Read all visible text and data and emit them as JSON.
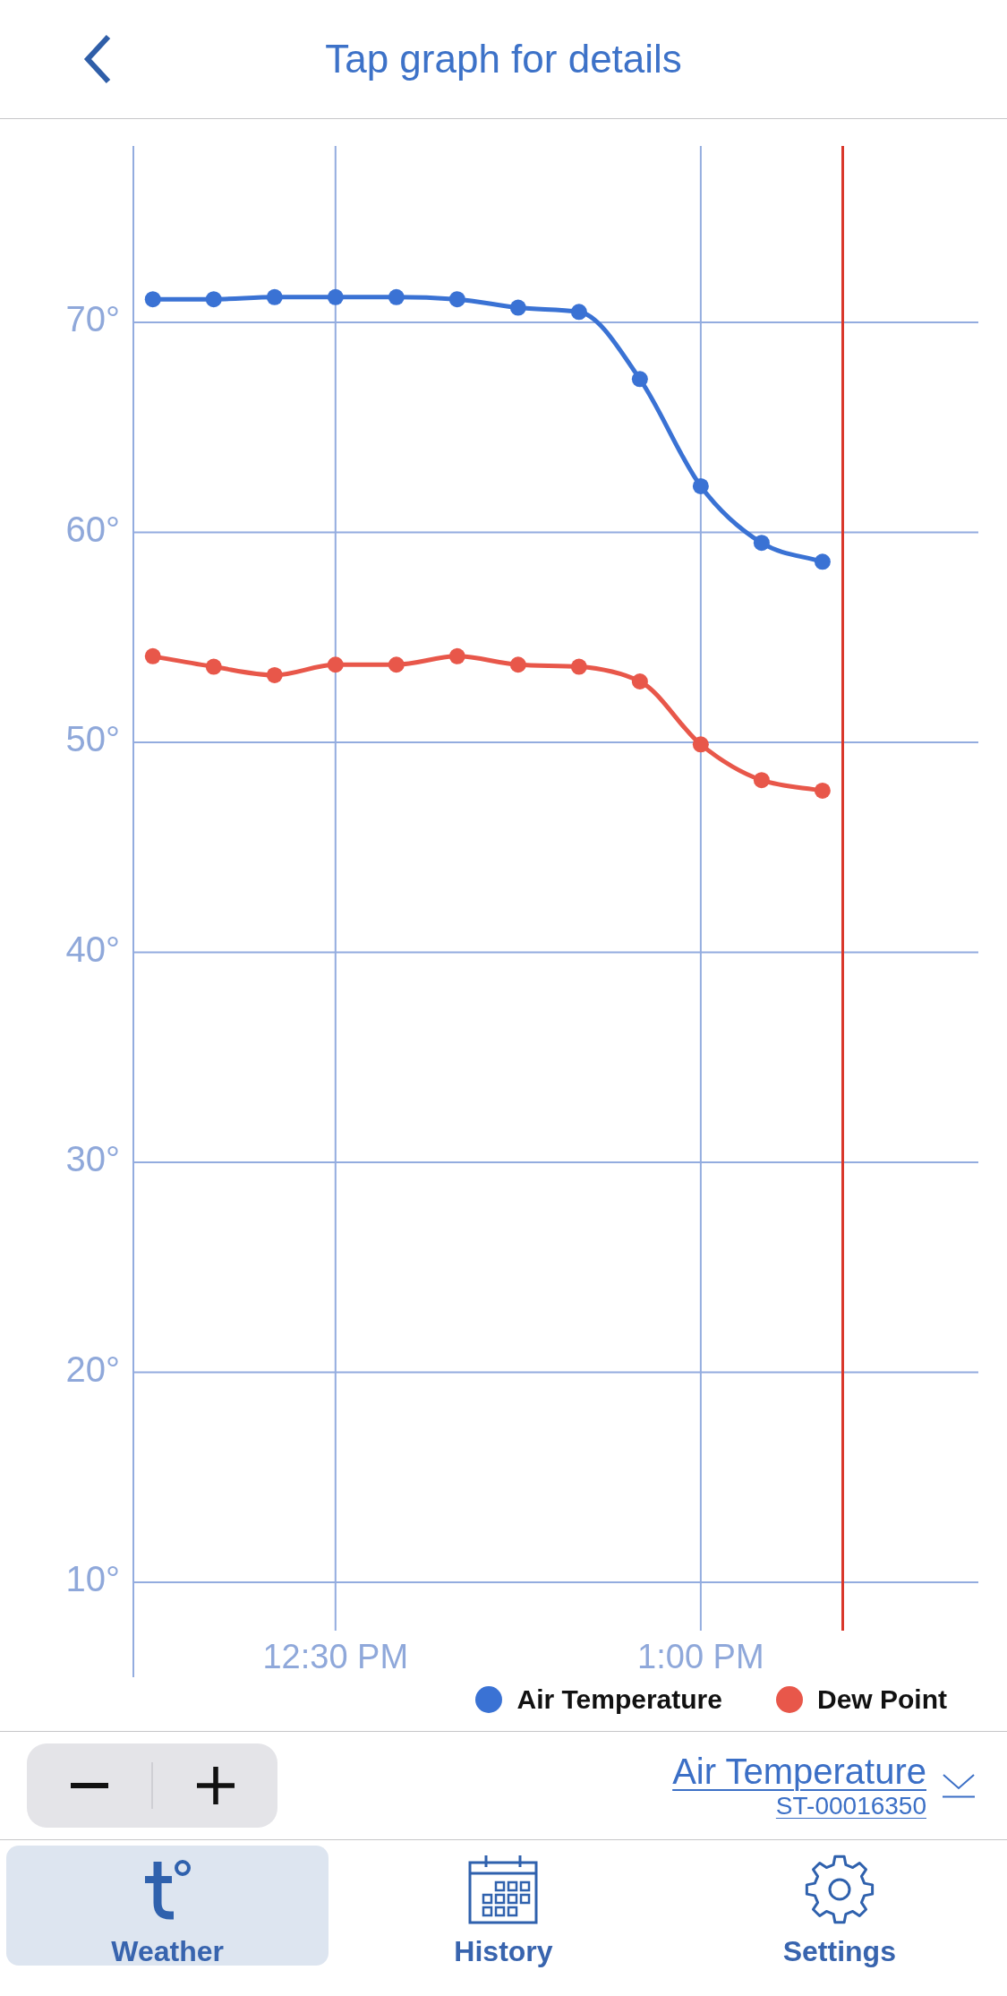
{
  "header": {
    "title": "Tap graph for details"
  },
  "chart": {
    "chart_data": {
      "type": "line",
      "categories": [
        null,
        null,
        null,
        "12:30 PM",
        null,
        null,
        null,
        null,
        null,
        "1:00 PM",
        null,
        null
      ],
      "series": [
        {
          "name": "Air Temperature",
          "color": "#3a72d4",
          "marker": "circle",
          "values": [
            71.1,
            71.1,
            71.2,
            71.2,
            71.2,
            71.1,
            70.7,
            70.5,
            67.3,
            62.2,
            59.5,
            58.6
          ]
        },
        {
          "name": "Dew Point",
          "color": "#e8574a",
          "marker": "circle",
          "values": [
            54.1,
            53.6,
            53.2,
            53.7,
            53.7,
            54.1,
            53.7,
            53.6,
            52.9,
            49.9,
            48.2,
            47.7
          ]
        }
      ],
      "ylim": [
        7.7,
        78.4
      ],
      "yticks": [
        {
          "value": 10,
          "label": "10°"
        },
        {
          "value": 20,
          "label": "20°"
        },
        {
          "value": 30,
          "label": "30°"
        },
        {
          "value": 40,
          "label": "40°"
        },
        {
          "value": 50,
          "label": "50°"
        },
        {
          "value": 60,
          "label": "60°"
        },
        {
          "value": 70,
          "label": "70°"
        }
      ],
      "grid": true,
      "legend": true
    }
  },
  "selector": {
    "metric": "Air Temperature",
    "station": "ST-00016350"
  },
  "tabs": [
    {
      "label": "Weather",
      "selected": true
    },
    {
      "label": "History",
      "selected": false
    },
    {
      "label": "Settings",
      "selected": false
    }
  ]
}
